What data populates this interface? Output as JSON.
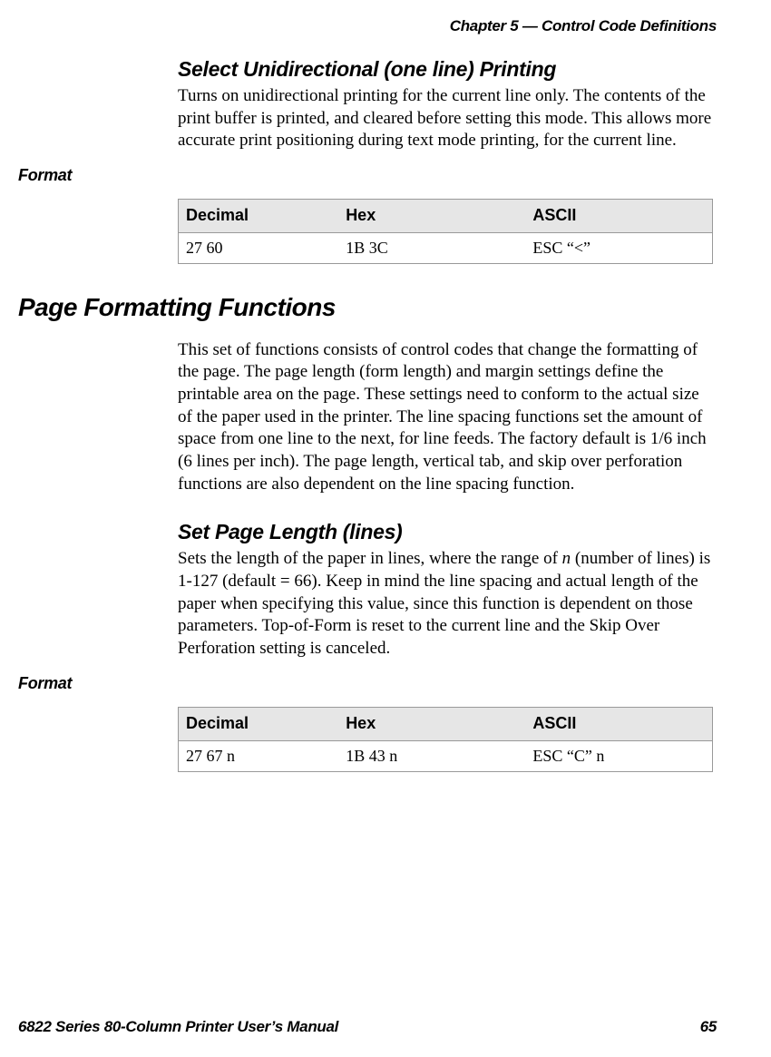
{
  "header": {
    "chapter": "Chapter 5 — Control Code Definitions"
  },
  "section1": {
    "title": "Select Unidirectional (one line) Printing",
    "body": "Turns on unidirectional printing for the current line only. The contents of the print buffer is printed, and cleared before setting this mode. This allows more accurate print positioning during text mode printing, for the current line."
  },
  "format_label": "Format",
  "table1": {
    "headers": [
      "Decimal",
      "Hex",
      "ASCII"
    ],
    "row": [
      "27 60",
      "1B 3C",
      "ESC “<”"
    ]
  },
  "major_section": {
    "title": "Page Formatting Functions",
    "body": "This set of functions consists of control codes that change the formatting of the page. The page length (form length) and margin settings define the printable area on the page. These settings need to conform to the actual size of the paper used in the printer. The line spacing functions set the amount of space from one line to the next, for line feeds. The factory default is 1/6 inch (6 lines per inch). The page length, vertical tab, and skip over perforation functions are also dependent on the line spacing function."
  },
  "section2": {
    "title": "Set Page Length (lines)",
    "body_pre": "Sets the length of the paper in lines, where the range of ",
    "body_em": "n",
    "body_post": " (number of lines) is 1-127 (default = 66). Keep in mind the line spacing and actual length of the paper when specifying this value, since this function is dependent on those parameters. Top-of-Form is reset to the current line and the Skip Over Perforation setting is canceled."
  },
  "table2": {
    "headers": [
      "Decimal",
      "Hex",
      "ASCII"
    ],
    "row": [
      "27 67 n",
      "1B 43 n",
      "ESC “C” n"
    ]
  },
  "footer": {
    "manual": "6822 Series 80-Column Printer User’s Manual",
    "page": "65"
  }
}
